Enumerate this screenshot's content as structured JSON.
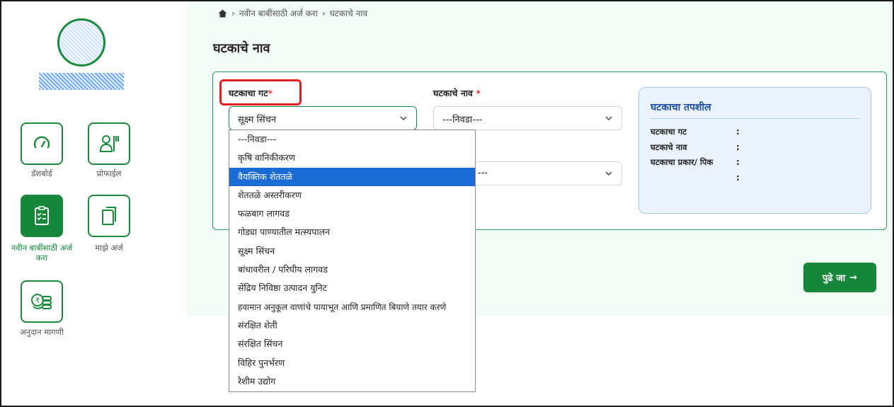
{
  "breadcrumb": {
    "home_icon": "home-icon",
    "item1": "नवीन बाबींसाठी अर्ज करा",
    "item2": "घटकाचे नाव"
  },
  "page": {
    "title": "घटकाचे नाव"
  },
  "sidebar": {
    "items": [
      {
        "label": "डॅशबोर्ड",
        "icon": "dashboard-gauge-icon"
      },
      {
        "label": "प्रोफाईल",
        "icon": "profile-icon"
      },
      {
        "label": "नवीन बाबींसाठी अर्ज करा",
        "icon": "checklist-icon",
        "active": true
      },
      {
        "label": "माझे अर्ज",
        "icon": "documents-icon"
      },
      {
        "label": "अनुदान मागणी",
        "icon": "coins-icon"
      }
    ]
  },
  "form": {
    "group_label": "घटकाचा गट",
    "group_value": "सूक्ष्म सिंचन",
    "name_label": "घटकाचे नाव",
    "name_value": "---निवडा---",
    "third_value": "---",
    "required_mark": "*"
  },
  "dropdown": {
    "options": [
      "---निवडा---",
      "कृषि वानिकीकरण",
      "वैयक्तिक शेततळे",
      "शेततळे अस्तरीकरण",
      "फळबाग लागवड",
      "गोड्या पाण्यातील मत्स्यपालन",
      "सूक्ष्म सिंचन",
      "बांधावरील / परिघीय लागवड",
      "सेंद्रिय निविष्ठा उत्पादन युनिट",
      "हवामान अनुकूल वाणांचे पायाभूत आणि प्रमाणित बियाणे तयार करणे",
      "संरक्षित शेती",
      "संरक्षित सिंचन",
      "विहिर पुनर्भरण",
      "रेशीम उद्योग"
    ],
    "highlighted": "वैयक्तिक शेततळे"
  },
  "details": {
    "title": "घटकाचा तपशील",
    "rows": [
      "घटकाचा गट",
      "घटकाचे नाव",
      "घटकाचा प्रकार/ पिक"
    ],
    "colon": ":"
  },
  "actions": {
    "next_label": "पुढे जा"
  },
  "colors": {
    "brand_green": "#16873a",
    "highlight_red": "#e02020",
    "selected_blue": "#1a6bd6",
    "info_bg": "#e9f2fd"
  }
}
